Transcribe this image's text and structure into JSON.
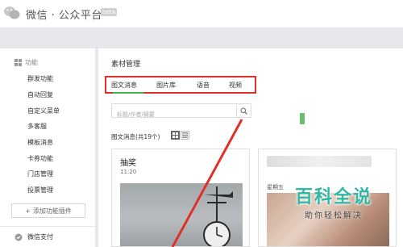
{
  "header": {
    "title": "微信 · 公众平台",
    "badge": "beta"
  },
  "sidebar": {
    "section_title": "功能",
    "items": [
      {
        "label": "群发功能"
      },
      {
        "label": "自动回复"
      },
      {
        "label": "自定义菜单"
      },
      {
        "label": "多客服"
      },
      {
        "label": "模板消息"
      },
      {
        "label": "卡券功能"
      },
      {
        "label": "门店管理"
      },
      {
        "label": "投票管理"
      }
    ],
    "add_plugin": "添加功能插件",
    "pay": "微信支付"
  },
  "main": {
    "title": "素材管理",
    "tabs": [
      {
        "label": "图文消息",
        "active": true
      },
      {
        "label": "图片库",
        "active": false
      },
      {
        "label": "语音",
        "active": false
      },
      {
        "label": "视频",
        "active": false
      }
    ],
    "search": {
      "placeholder": "标题/作者/摘要",
      "value": ""
    },
    "count_label": "图文消息(共19个)",
    "cards": [
      {
        "title": "抽奖",
        "time": "11:20"
      },
      {
        "day": "星期五"
      }
    ]
  },
  "watermark": {
    "main": "百科全说",
    "sub": "助你轻松解决"
  },
  "colors": {
    "accent_green": "#44b549",
    "highlight_red": "#e0302a",
    "watermark_teal": "#31b7a5"
  }
}
